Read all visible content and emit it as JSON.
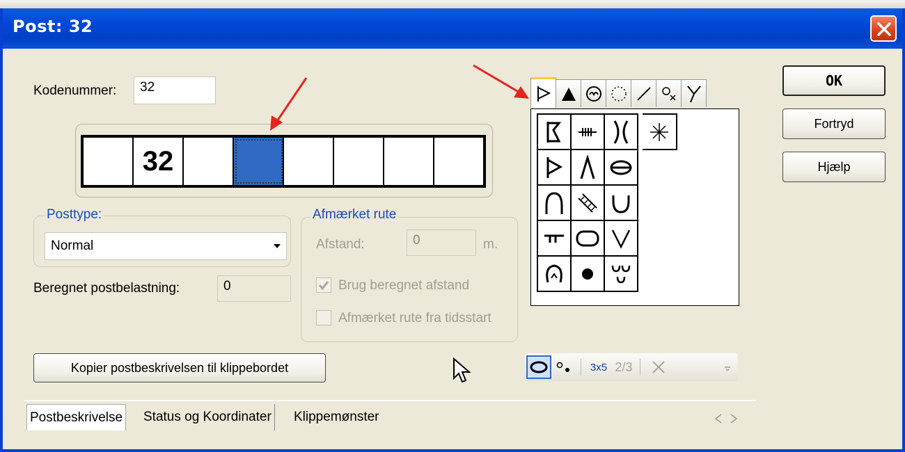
{
  "window": {
    "title": "Post: 32"
  },
  "kodenummer": {
    "label": "Kodenummer:",
    "value": "32"
  },
  "code_cells": [
    "",
    "32",
    "",
    "",
    "",
    "",
    "",
    ""
  ],
  "selected_cell_index": 3,
  "posttype": {
    "group_label": "Posttype:",
    "selected": "Normal"
  },
  "beregnet": {
    "label": "Beregnet postbelastning:",
    "value": "0"
  },
  "afmaerket": {
    "group_label": "Afmærket rute",
    "afstand_label": "Afstand:",
    "afstand_value": "0",
    "unit": "m.",
    "check1_label": "Brug beregnet afstand",
    "check1_checked": true,
    "check2_label": "Afmærket rute fra tidsstart",
    "check2_checked": false
  },
  "buttons": {
    "ok": "OK",
    "cancel": "Fortryd",
    "help": "Hjælp",
    "copy": "Kopier postbeskrivelsen til klippebordet"
  },
  "toolbar": {
    "size_label": "3x5",
    "fraction_label": "2/3"
  },
  "bottom_tabs": [
    "Postbeskrivelse",
    "Status og Koordinater",
    "Klippemønster"
  ],
  "palette_tabs": [
    "flag-icon",
    "triangle-icon",
    "face-icon",
    "dotted-circle-icon",
    "line-icon",
    "circle-x-icon",
    "fork-icon"
  ],
  "palette_symbols": [
    "flag-a-icon",
    "fence-icon",
    "bracket-icon",
    "flag-b-icon",
    "fork-line-icon",
    "cylinder-icon",
    "arch-icon",
    "bridge-icon",
    "cup-icon",
    "pipe-icon",
    "rounded-rect-icon",
    "v-icon",
    "horseshoe-icon",
    "dot-icon",
    "drops-icon"
  ],
  "extra_symbol": "asterisk-icon",
  "colors": {
    "titlebar": "#0047d6",
    "selection": "#316AC5",
    "annotation_arrow": "#e8231e"
  }
}
